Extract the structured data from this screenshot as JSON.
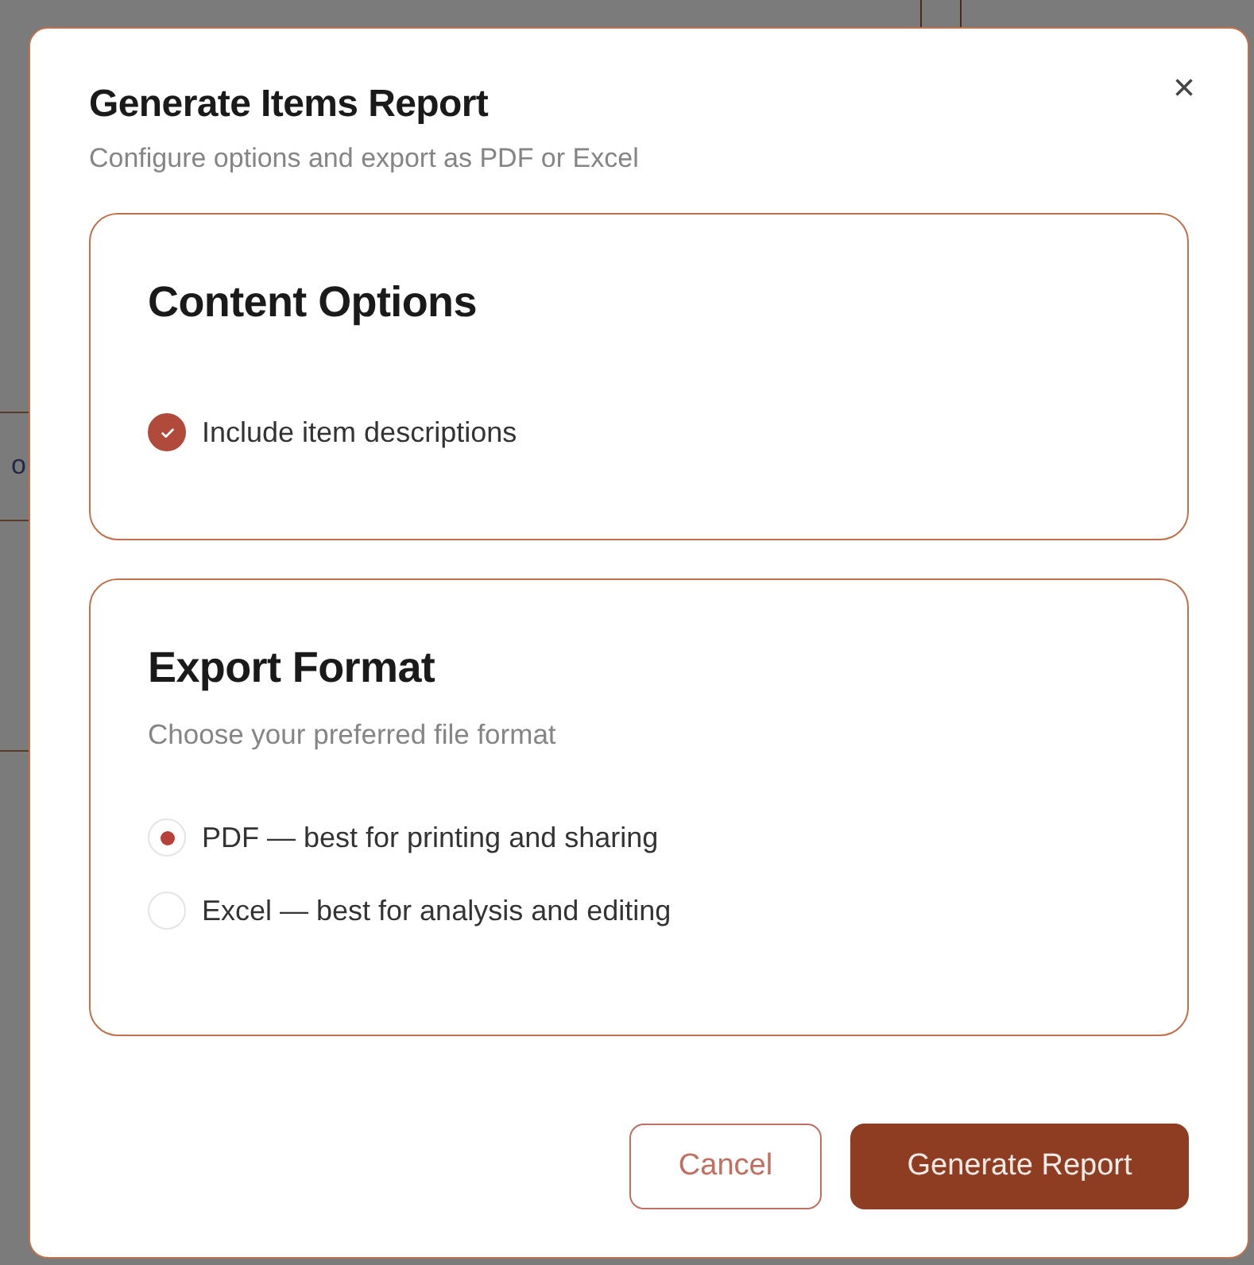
{
  "backdrop": {
    "text_fragment": "o"
  },
  "dialog": {
    "title": "Generate Items Report",
    "subtitle": "Configure options and export as PDF or Excel",
    "close": "×"
  },
  "content_options": {
    "title": "Content Options",
    "options": [
      {
        "label": "Include item descriptions",
        "checked": true
      }
    ]
  },
  "export_format": {
    "title": "Export Format",
    "subtitle": "Choose your preferred file format",
    "options": [
      {
        "label": "PDF — best for printing and sharing",
        "selected": true
      },
      {
        "label": "Excel — best for analysis and editing",
        "selected": false
      }
    ]
  },
  "buttons": [
    {
      "label": "Cancel",
      "kind": "secondary"
    },
    {
      "label": "Generate Report",
      "kind": "primary"
    }
  ]
}
